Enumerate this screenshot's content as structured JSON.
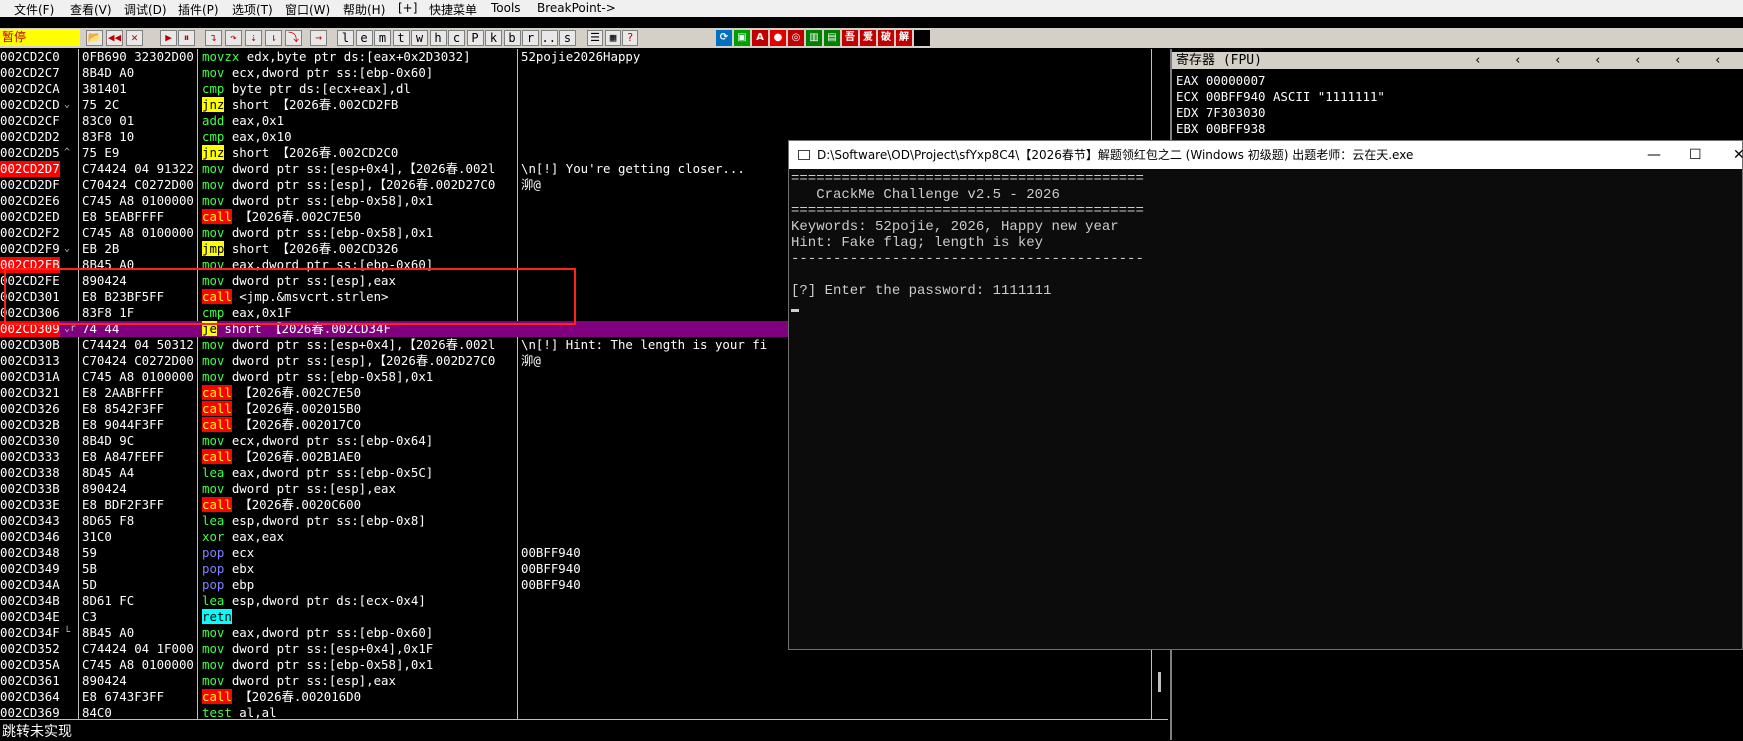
{
  "menu": [
    "文件(F)",
    "查看(V)",
    "调试(D)",
    "插件(P)",
    "选项(T)",
    "窗口(W)",
    "帮助(H)",
    "[+]",
    "快捷菜单",
    "Tools",
    "BreakPoint->"
  ],
  "toolbar": {
    "status": "暂停",
    "letter_buttons": [
      "l",
      "e",
      "m",
      "t",
      "w",
      "h",
      "c",
      "P",
      "k",
      "b",
      "r",
      "...",
      "s"
    ]
  },
  "disasm": [
    {
      "addr": "002CD2C0",
      "marker": "",
      "hex": "0FB690 32302D00",
      "ops": [
        [
          "movzx",
          "k-movzx"
        ],
        [
          " edx,byte ptr ds:[eax+0x2D3032]",
          "ops"
        ]
      ],
      "comment": "52pojie2026Happy",
      "addr_red": false
    },
    {
      "addr": "002CD2C7",
      "marker": "",
      "hex": "8B4D A0",
      "ops": [
        [
          "mov",
          "k-mov"
        ],
        [
          " ecx,dword ptr ss:[ebp-0x60]",
          "ops"
        ]
      ],
      "comment": "",
      "addr_red": false
    },
    {
      "addr": "002CD2CA",
      "marker": "",
      "hex": "381401",
      "ops": [
        [
          "cmp",
          "k-cmp"
        ],
        [
          " byte ptr ds:[ecx+eax],dl",
          "ops"
        ]
      ],
      "comment": "",
      "addr_red": false
    },
    {
      "addr": "002CD2CD",
      "marker": "⌄",
      "hex": "75 2C",
      "ops": [
        [
          "jnz",
          "kw-yel"
        ],
        [
          " short 【2026春.002CD2FB",
          "ops"
        ]
      ],
      "comment": "",
      "addr_red": false
    },
    {
      "addr": "002CD2CF",
      "marker": "",
      "hex": "83C0 01",
      "ops": [
        [
          "add",
          "k-add"
        ],
        [
          " eax,0x1",
          "ops"
        ]
      ],
      "comment": "",
      "addr_red": false
    },
    {
      "addr": "002CD2D2",
      "marker": "",
      "hex": "83F8 10",
      "ops": [
        [
          "cmp",
          "k-cmp"
        ],
        [
          " eax,0x10",
          "ops"
        ]
      ],
      "comment": "",
      "addr_red": false
    },
    {
      "addr": "002CD2D5",
      "marker": "^",
      "hex": "75 E9",
      "ops": [
        [
          "jnz",
          "kw-yel"
        ],
        [
          " short 【2026春.002CD2C0",
          "ops"
        ]
      ],
      "comment": "",
      "addr_red": false
    },
    {
      "addr": "002CD2D7",
      "marker": "",
      "hex": "C74424 04 91322",
      "ops": [
        [
          "mov",
          "k-mov"
        ],
        [
          " dword ptr ss:[esp+0x4],【2026春.002l",
          "ops"
        ]
      ],
      "comment": "\\n[!] You're getting closer...",
      "addr_red": true
    },
    {
      "addr": "002CD2DF",
      "marker": "",
      "hex": "C70424 C0272D00",
      "ops": [
        [
          "mov",
          "k-mov"
        ],
        [
          " dword ptr ss:[esp],【2026春.002D27C0",
          "ops"
        ]
      ],
      "comment": "泖@",
      "addr_red": false
    },
    {
      "addr": "002CD2E6",
      "marker": "",
      "hex": "C745 A8 0100000",
      "ops": [
        [
          "mov",
          "k-mov"
        ],
        [
          " dword ptr ss:[ebp-0x58],0x1",
          "ops"
        ]
      ],
      "comment": "",
      "addr_red": false
    },
    {
      "addr": "002CD2ED",
      "marker": "",
      "hex": "E8 5EABFFFF",
      "ops": [
        [
          "call",
          "kw-red"
        ],
        [
          " 【2026春.002C7E50",
          "ops"
        ]
      ],
      "comment": "",
      "addr_red": false
    },
    {
      "addr": "002CD2F2",
      "marker": "",
      "hex": "C745 A8 0100000",
      "ops": [
        [
          "mov",
          "k-mov"
        ],
        [
          " dword ptr ss:[ebp-0x58],0x1",
          "ops"
        ]
      ],
      "comment": "",
      "addr_red": false
    },
    {
      "addr": "002CD2F9",
      "marker": "⌄",
      "hex": "EB 2B",
      "ops": [
        [
          "jmp",
          "kw-yel"
        ],
        [
          " short 【2026春.002CD326",
          "ops"
        ]
      ],
      "comment": "",
      "addr_red": false
    },
    {
      "addr": "002CD2FB",
      "marker": "",
      "hex": "8B45 A0",
      "ops": [
        [
          "mov",
          "k-mov"
        ],
        [
          " eax,dword ptr ss:[ebp-0x60]",
          "ops"
        ]
      ],
      "comment": "",
      "addr_red": true
    },
    {
      "addr": "002CD2FE",
      "marker": "",
      "hex": "890424",
      "ops": [
        [
          "mov",
          "k-mov"
        ],
        [
          " dword ptr ss:[esp],eax",
          "ops"
        ]
      ],
      "comment": "",
      "addr_red": false
    },
    {
      "addr": "002CD301",
      "marker": "",
      "hex": "E8 B23BF5FF",
      "ops": [
        [
          "call",
          "kw-red"
        ],
        [
          " <jmp.&msvcrt.strlen>",
          "ops"
        ]
      ],
      "comment": "",
      "addr_red": false
    },
    {
      "addr": "002CD306",
      "marker": "",
      "hex": "83F8 1F",
      "ops": [
        [
          "cmp",
          "k-cmp"
        ],
        [
          " eax,0x1F",
          "ops"
        ]
      ],
      "comment": "",
      "addr_red": false
    },
    {
      "addr": "002CD309",
      "marker": "⌄r",
      "hex": "74 44",
      "ops": [
        [
          "je",
          "kw-yel"
        ],
        [
          " short 【2026春.002CD34F",
          "ops"
        ]
      ],
      "comment": "",
      "addr_red": true,
      "selected": true
    },
    {
      "addr": "002CD30B",
      "marker": "",
      "hex": "C74424 04 50312",
      "ops": [
        [
          "mov",
          "k-mov"
        ],
        [
          " dword ptr ss:[esp+0x4],【2026春.002l",
          "ops"
        ]
      ],
      "comment": "\\n[!] Hint: The length is your fi",
      "addr_red": false
    },
    {
      "addr": "002CD313",
      "marker": "",
      "hex": "C70424 C0272D00",
      "ops": [
        [
          "mov",
          "k-mov"
        ],
        [
          " dword ptr ss:[esp],【2026春.002D27C0",
          "ops"
        ]
      ],
      "comment": "泖@",
      "addr_red": false
    },
    {
      "addr": "002CD31A",
      "marker": "",
      "hex": "C745 A8 0100000",
      "ops": [
        [
          "mov",
          "k-mov"
        ],
        [
          " dword ptr ss:[ebp-0x58],0x1",
          "ops"
        ]
      ],
      "comment": "",
      "addr_red": false
    },
    {
      "addr": "002CD321",
      "marker": "",
      "hex": "E8 2AABFFFF",
      "ops": [
        [
          "call",
          "kw-red"
        ],
        [
          " 【2026春.002C7E50",
          "ops"
        ]
      ],
      "comment": "",
      "addr_red": false
    },
    {
      "addr": "002CD326",
      "marker": "",
      "hex": "E8 8542F3FF",
      "ops": [
        [
          "call",
          "kw-red"
        ],
        [
          " 【2026春.002015B0",
          "ops"
        ]
      ],
      "comment": "",
      "addr_red": false
    },
    {
      "addr": "002CD32B",
      "marker": "",
      "hex": "E8 9044F3FF",
      "ops": [
        [
          "call",
          "kw-red"
        ],
        [
          " 【2026春.002017C0",
          "ops"
        ]
      ],
      "comment": "",
      "addr_red": false
    },
    {
      "addr": "002CD330",
      "marker": "",
      "hex": "8B4D 9C",
      "ops": [
        [
          "mov",
          "k-mov"
        ],
        [
          " ecx,dword ptr ss:[ebp-0x64]",
          "ops"
        ]
      ],
      "comment": "",
      "addr_red": false
    },
    {
      "addr": "002CD333",
      "marker": "",
      "hex": "E8 A847FEFF",
      "ops": [
        [
          "call",
          "kw-red"
        ],
        [
          " 【2026春.002B1AE0",
          "ops"
        ]
      ],
      "comment": "",
      "addr_red": false
    },
    {
      "addr": "002CD338",
      "marker": "",
      "hex": "8D45 A4",
      "ops": [
        [
          "lea",
          "k-lea"
        ],
        [
          " eax,dword ptr ss:[ebp-0x5C]",
          "ops"
        ]
      ],
      "comment": "",
      "addr_red": false
    },
    {
      "addr": "002CD33B",
      "marker": "",
      "hex": "890424",
      "ops": [
        [
          "mov",
          "k-mov"
        ],
        [
          " dword ptr ss:[esp],eax",
          "ops"
        ]
      ],
      "comment": "",
      "addr_red": false
    },
    {
      "addr": "002CD33E",
      "marker": "",
      "hex": "E8 BDF2F3FF",
      "ops": [
        [
          "call",
          "kw-red"
        ],
        [
          " 【2026春.0020C600",
          "ops"
        ]
      ],
      "comment": "",
      "addr_red": false
    },
    {
      "addr": "002CD343",
      "marker": "",
      "hex": "8D65 F8",
      "ops": [
        [
          "lea",
          "k-lea"
        ],
        [
          " esp,dword ptr ss:[ebp-0x8]",
          "ops"
        ]
      ],
      "comment": "",
      "addr_red": false
    },
    {
      "addr": "002CD346",
      "marker": "",
      "hex": "31C0",
      "ops": [
        [
          "xor",
          "k-xor"
        ],
        [
          " eax,eax",
          "ops"
        ]
      ],
      "comment": "",
      "addr_red": false
    },
    {
      "addr": "002CD348",
      "marker": "",
      "hex": "59",
      "ops": [
        [
          "pop",
          "k-pop"
        ],
        [
          " ecx",
          "ops"
        ]
      ],
      "comment": "00BFF940",
      "addr_red": false
    },
    {
      "addr": "002CD349",
      "marker": "",
      "hex": "5B",
      "ops": [
        [
          "pop",
          "k-pop"
        ],
        [
          " ebx",
          "ops"
        ]
      ],
      "comment": "00BFF940",
      "addr_red": false
    },
    {
      "addr": "002CD34A",
      "marker": "",
      "hex": "5D",
      "ops": [
        [
          "pop",
          "k-pop"
        ],
        [
          " ebp",
          "ops"
        ]
      ],
      "comment": "00BFF940",
      "addr_red": false
    },
    {
      "addr": "002CD34B",
      "marker": "",
      "hex": "8D61 FC",
      "ops": [
        [
          "lea",
          "k-lea"
        ],
        [
          " esp,dword ptr ds:[ecx-0x4]",
          "ops"
        ]
      ],
      "comment": "",
      "addr_red": false
    },
    {
      "addr": "002CD34E",
      "marker": "",
      "hex": "C3",
      "ops": [
        [
          "retn",
          "kw-cyan"
        ]
      ],
      "comment": "",
      "addr_red": false
    },
    {
      "addr": "002CD34F",
      "marker": "└",
      "hex": "8B45 A0",
      "ops": [
        [
          "mov",
          "k-mov"
        ],
        [
          " eax,dword ptr ss:[ebp-0x60]",
          "ops"
        ]
      ],
      "comment": "",
      "addr_red": false
    },
    {
      "addr": "002CD352",
      "marker": "",
      "hex": "C74424 04 1F000",
      "ops": [
        [
          "mov",
          "k-mov"
        ],
        [
          " dword ptr ss:[esp+0x4],0x1F",
          "ops"
        ]
      ],
      "comment": "",
      "addr_red": false
    },
    {
      "addr": "002CD35A",
      "marker": "",
      "hex": "C745 A8 0100000",
      "ops": [
        [
          "mov",
          "k-mov"
        ],
        [
          " dword ptr ss:[ebp-0x58],0x1",
          "ops"
        ]
      ],
      "comment": "",
      "addr_red": false
    },
    {
      "addr": "002CD361",
      "marker": "",
      "hex": "890424",
      "ops": [
        [
          "mov",
          "k-mov"
        ],
        [
          " dword ptr ss:[esp],eax",
          "ops"
        ]
      ],
      "comment": "",
      "addr_red": false
    },
    {
      "addr": "002CD364",
      "marker": "",
      "hex": "E8 6743F3FF",
      "ops": [
        [
          "call",
          "kw-red"
        ],
        [
          " 【2026春.002016D0",
          "ops"
        ]
      ],
      "comment": "",
      "addr_red": false
    },
    {
      "addr": "002CD369",
      "marker": "",
      "hex": "84C0",
      "ops": [
        [
          "test",
          "k-test"
        ],
        [
          " al,al",
          "ops"
        ]
      ],
      "comment": "",
      "addr_red": false
    }
  ],
  "bottom_status": "跳转未实现",
  "registers": {
    "header": "寄存器 (FPU)",
    "lines": [
      "EAX 00000007",
      "ECX 00BFF940 ASCII \"1111111\"",
      "EDX 7F303030",
      "EBX 00BFF938"
    ]
  },
  "console": {
    "title": "D:\\Software\\OD\\Project\\sfYxp8C4\\【2026春节】解题领红包之二 (Windows 初级题) 出题老师：云在天.exe",
    "lines": [
      "==========================================",
      "   CrackMe Challenge v2.5 - 2026",
      "==========================================",
      "Keywords: 52pojie, 2026, Happy new year",
      "Hint: Fake flag; length is key",
      "------------------------------------------",
      "",
      "[?] Enter the password: 1111111"
    ],
    "minimize": "—",
    "maximize": "☐",
    "close": "✕"
  }
}
